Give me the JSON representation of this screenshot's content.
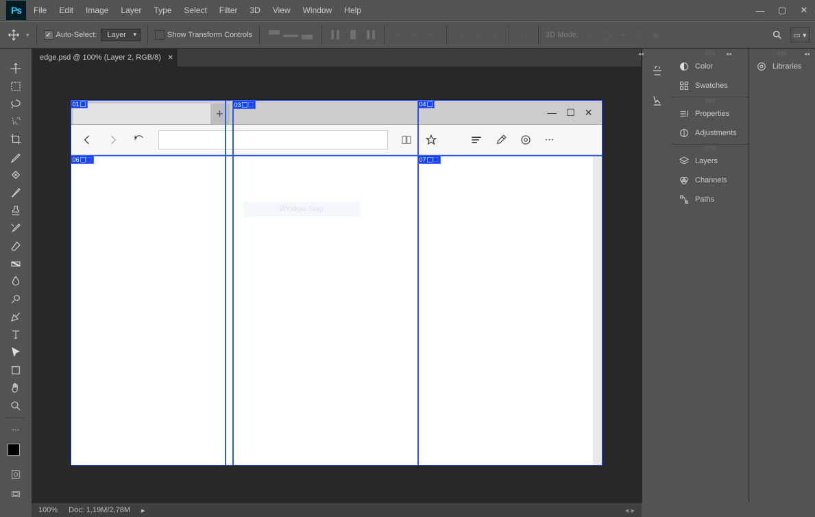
{
  "app": {
    "badge": "Ps"
  },
  "menu": [
    "File",
    "Edit",
    "Image",
    "Layer",
    "Type",
    "Select",
    "Filter",
    "3D",
    "View",
    "Window",
    "Help"
  ],
  "options": {
    "auto_select": "Auto-Select:",
    "layer": "Layer",
    "show_transform": "Show Transform Controls",
    "mode_3d": "3D Mode:"
  },
  "doc_tab": "edge.psd @ 100% (Layer 2, RGB/8)",
  "slices": {
    "s01": "01",
    "s03": "03",
    "s04": "04",
    "s06": "06",
    "s07": "07"
  },
  "browser": {
    "faint_label": "Window Snip"
  },
  "panels": {
    "color": "Color",
    "swatches": "Swatches",
    "properties": "Properties",
    "adjustments": "Adjustments",
    "layers": "Layers",
    "channels": "Channels",
    "paths": "Paths",
    "libraries": "Libraries"
  },
  "status": {
    "zoom": "100%",
    "doc": "Doc: 1,19M/2,78M"
  }
}
